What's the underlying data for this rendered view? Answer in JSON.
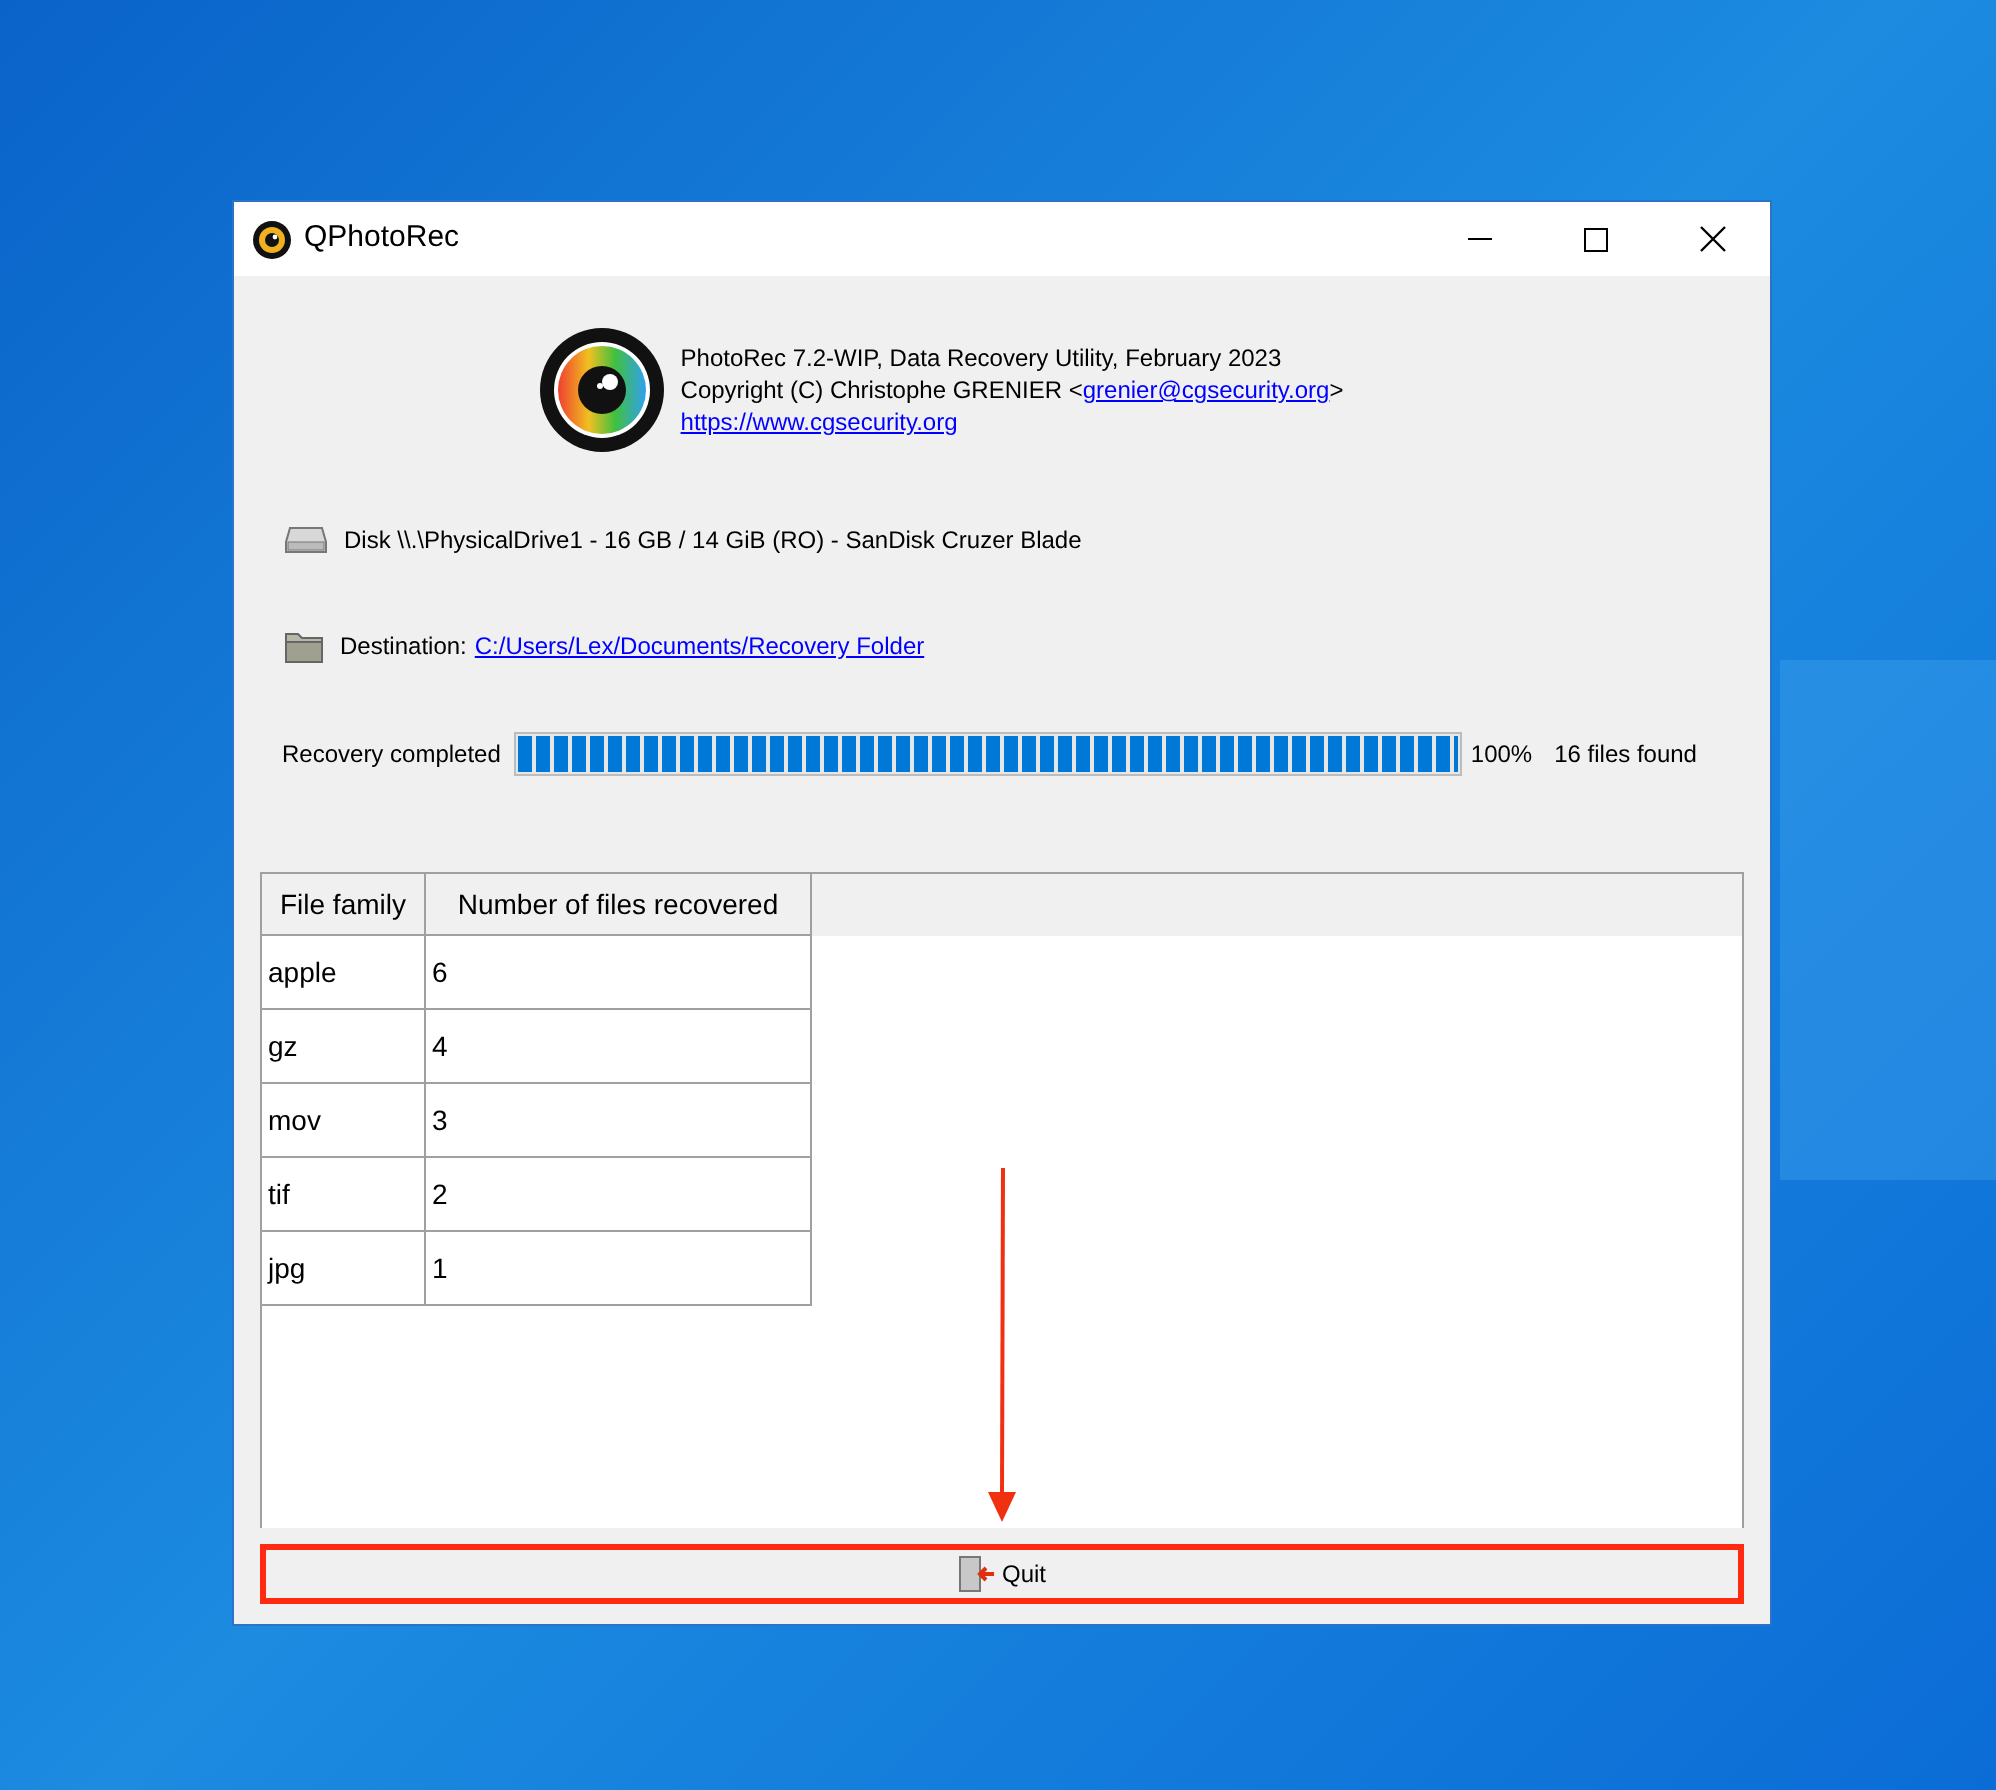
{
  "window": {
    "title": "QPhotoRec"
  },
  "about": {
    "line_1": "PhotoRec 7.2-WIP, Data Recovery Utility, February 2023",
    "copyright": "Copyright (C) Christophe GRENIER <",
    "email": "grenier@cgsecurity.org",
    "copyright_end": ">",
    "website": "https://www.cgsecurity.org"
  },
  "disk": {
    "label": "Disk \\\\.\\PhysicalDrive1 - 16 GB / 14 GiB (RO) - SanDisk Cruzer Blade"
  },
  "destination": {
    "label": "Destination:",
    "path": "C:/Users/Lex/Documents/Recovery Folder"
  },
  "progress": {
    "label": "Recovery completed",
    "level": 1,
    "percent": "100%",
    "status": "16 files found"
  },
  "table": {
    "columns": [
      "File family",
      "Number of files recovered"
    ],
    "rows": [
      [
        "apple",
        "6"
      ],
      [
        "gz",
        "4"
      ],
      [
        "mov",
        "3"
      ],
      [
        "tif",
        "2"
      ],
      [
        "jpg",
        "1"
      ]
    ]
  },
  "quit_button": {
    "label": "Quit"
  }
}
